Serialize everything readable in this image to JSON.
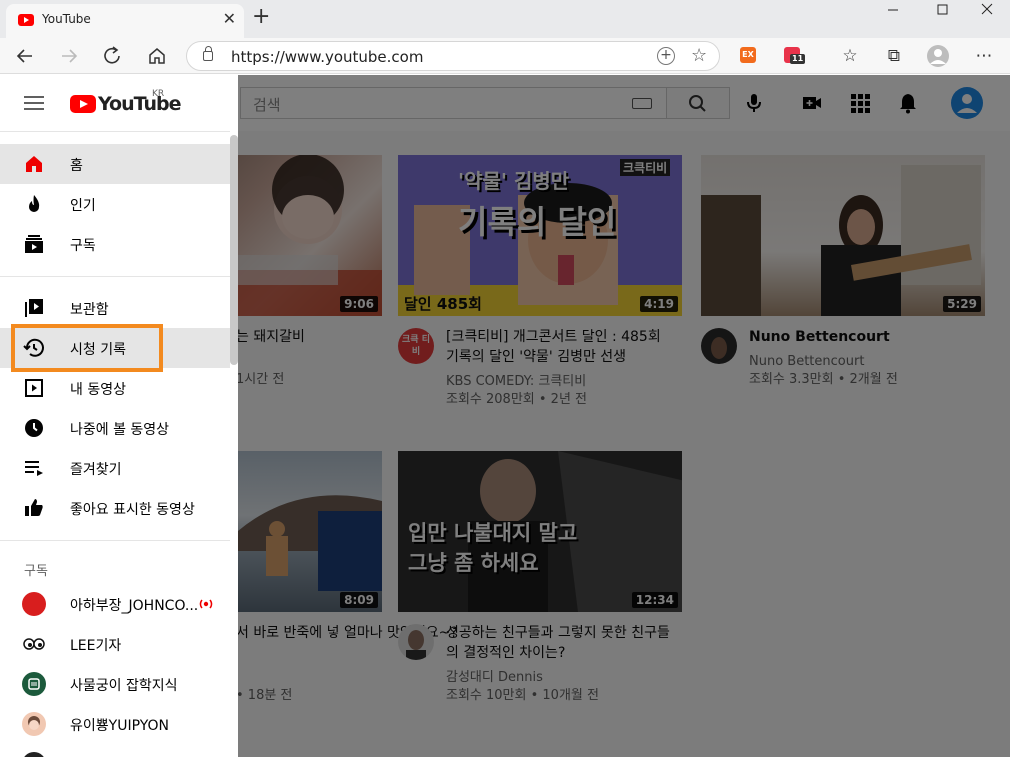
{
  "browser": {
    "tab_title": "YouTube",
    "tab_close": "✕",
    "new_tab": "+",
    "url": "https://www.youtube.com",
    "ext_badge": "11",
    "ext1_label": "EX"
  },
  "header": {
    "search_placeholder": "검색"
  },
  "logo": {
    "wordmark": "YouTube",
    "region": "KR"
  },
  "drawer": {
    "items": [
      {
        "label": "홈",
        "icon": "home-icon"
      },
      {
        "label": "인기",
        "icon": "trending-icon"
      },
      {
        "label": "구독",
        "icon": "subscriptions-icon"
      }
    ],
    "library": [
      {
        "label": "보관함",
        "icon": "library-icon"
      },
      {
        "label": "시청 기록",
        "icon": "history-icon"
      },
      {
        "label": "내 동영상",
        "icon": "my-videos-icon"
      },
      {
        "label": "나중에 볼 동영상",
        "icon": "watch-later-icon"
      },
      {
        "label": "즐겨찾기",
        "icon": "playlist-icon"
      },
      {
        "label": "좋아요 표시한 동영상",
        "icon": "liked-icon"
      }
    ],
    "subscriptions_heading": "구독",
    "subscriptions": [
      {
        "label": "아하부장_JOHNCO..."
      },
      {
        "label": "LEE기자"
      },
      {
        "label": "사물궁이 잡학지식"
      },
      {
        "label": "유이뿅YUIPYON"
      }
    ]
  },
  "videos": [
    {
      "title": "는 돼지갈비",
      "channel": "",
      "meta": "1시간 전",
      "duration": "9:06"
    },
    {
      "title": "[크큭티비] 개그콘서트 달인 : 485회 기록의 달인 '약물' 김병만 선생",
      "channel": "KBS COMEDY: 크큭티비",
      "meta": "조회수 208만회 • 2년 전",
      "duration": "4:19",
      "thumb_text1": "'약물' 김병만",
      "thumb_text2": "기록의 달인",
      "thumb_text3": "달인 485회",
      "thumb_logo": "크큭티비",
      "avatar_text": "크큭 티비"
    },
    {
      "title": "Nuno Bettencourt",
      "channel": "Nuno Bettencourt",
      "meta": "조회수 3.3만회 • 2개월 전",
      "duration": "5:29"
    },
    {
      "title": "서 바로 반죽에 넣 얼마나 맛있게요~?",
      "channel": "",
      "meta": "• 18분 전",
      "duration": "8:09"
    },
    {
      "title": "성공하는 친구들과 그렇지 못한 친구들의 결정적인 차이는?",
      "channel": "감성대디 Dennis",
      "meta": "조회수 10만회 • 10개월 전",
      "duration": "12:34",
      "thumb_text1": "입만 나불대지 말고",
      "thumb_text2": "그냥 좀 하세요"
    }
  ],
  "colors": {
    "highlight": "#f38a1f",
    "brand": "#ff0000",
    "avatar": "#1e88e5"
  }
}
